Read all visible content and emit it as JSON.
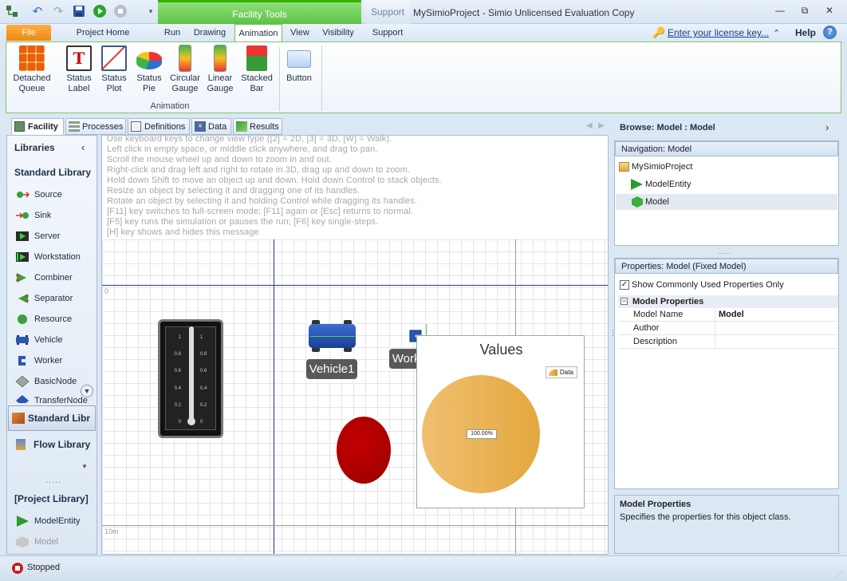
{
  "app": {
    "window_title": "MySimioProject - Simio Unlicensed Evaluation Copy",
    "context_tab_facility": "Facility Tools",
    "context_tab_support": "Support"
  },
  "window_controls": {
    "minimize": "—",
    "restore": "⧉",
    "close": "✕"
  },
  "tabs": {
    "file": "File",
    "project_home": "Project Home",
    "run": "Run",
    "drawing": "Drawing",
    "animation": "Animation",
    "view": "View",
    "visibility": "Visibility",
    "support": "Support"
  },
  "header": {
    "license_link": "Enter your license key...",
    "help": "Help",
    "collapse": "⌃"
  },
  "ribbon": {
    "buttons": [
      {
        "line1": "Detached",
        "line2": "Queue"
      },
      {
        "line1": "Status",
        "line2": "Label"
      },
      {
        "line1": "Status",
        "line2": "Plot"
      },
      {
        "line1": "Status",
        "line2": "Pie"
      },
      {
        "line1": "Circular",
        "line2": "Gauge"
      },
      {
        "line1": "Linear",
        "line2": "Gauge"
      },
      {
        "line1": "Stacked",
        "line2": "Bar"
      },
      {
        "line1": "Button",
        "line2": ""
      }
    ],
    "group_label": "Animation"
  },
  "view_tabs": {
    "facility": "Facility",
    "processes": "Processes",
    "definitions": "Definitions",
    "data": "Data",
    "results": "Results"
  },
  "libraries": {
    "header": "Libraries",
    "standard_title": "Standard Library",
    "items": [
      "Source",
      "Sink",
      "Server",
      "Workstation",
      "Combiner",
      "Separator",
      "Resource",
      "Vehicle",
      "Worker",
      "BasicNode",
      "TransferNode"
    ],
    "standard_tab": "Standard Libr",
    "flow_tab": "Flow Library",
    "project_title": "[Project Library]",
    "project_items": [
      "ModelEntity",
      "Model"
    ]
  },
  "canvas": {
    "hints": [
      "Use keyboard keys to change view type ([2] = 2D, [3] = 3D, [W] = Walk).",
      "Left click in empty space, or middle click anywhere, and drag to pan.",
      "Scroll the mouse wheel up and down to zoom in and out.",
      "Right-click and drag left and right to rotate in 3D, drag up and down to zoom.",
      "Hold down Shift to move an object up and down. Hold down Control to stack objects.",
      "Resize an object by selecting it and dragging one of its handles.",
      "Rotate an object by selecting it and holding Control while dragging its handles.",
      "[F11] key switches to full-screen mode; [F11] again or [Esc] returns to normal.",
      "[F5] key runs the simulation or pauses the run; [F6] key single-steps.",
      "[H] key shows and hides this message"
    ],
    "axis_zero": "0",
    "axis_ten": "10m",
    "vehicle_label": "Vehicle1",
    "worker_label": "Worker1",
    "gauge_ticks": [
      "1",
      "0.8",
      "0.6",
      "0.4",
      "0.2",
      "0"
    ],
    "pie_title": "Values",
    "pie_legend": "Data",
    "pie_value_label": "100.00%"
  },
  "chart_data": {
    "type": "pie",
    "title": "Values",
    "categories": [
      "Data"
    ],
    "values": [
      100
    ]
  },
  "right": {
    "browse_title": "Browse: Model : Model",
    "navigation_header": "Navigation: Model",
    "tree": [
      "MySimioProject",
      "ModelEntity",
      "Model"
    ],
    "properties_header": "Properties: Model (Fixed Model)",
    "show_common": "Show Commonly Used Properties Only",
    "prop_group": "Model Properties",
    "props": [
      {
        "name": "Model Name",
        "value": "Model"
      },
      {
        "name": "Author",
        "value": ""
      },
      {
        "name": "Description",
        "value": ""
      }
    ],
    "desc_title": "Model Properties",
    "desc_text": "Specifies the properties for this object class."
  },
  "status": {
    "text": "Stopped"
  },
  "colors": {
    "accent_green": "#5cc247",
    "file_orange": "#f08a10",
    "pie_gold": "#e3a73e",
    "ellipse_red": "#b00000"
  }
}
